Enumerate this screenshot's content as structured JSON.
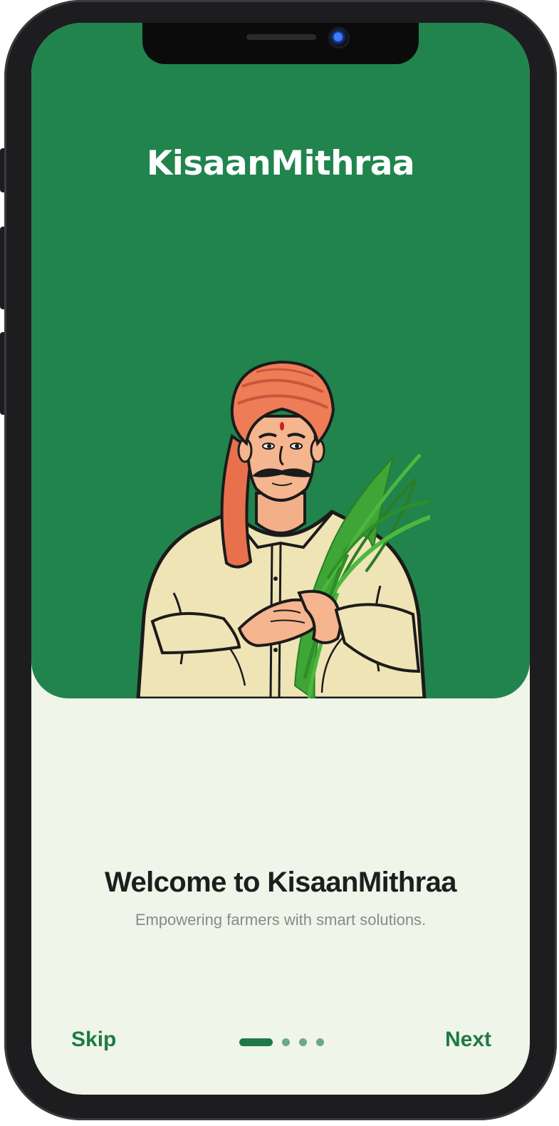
{
  "header": {
    "app_name": "KisaanMithraa"
  },
  "hero": {
    "illustration_icon": "farmer-with-crop-illustration"
  },
  "content": {
    "heading": "Welcome to KisaanMithraa",
    "subtitle": "Empowering farmers with smart solutions."
  },
  "footer": {
    "skip_label": "Skip",
    "next_label": "Next",
    "pager": {
      "total": 4,
      "current": 1
    }
  },
  "colors": {
    "brand_green": "#21844D",
    "accent_green": "#1F7A45",
    "background": "#EFF5E8",
    "heading_text": "#1E1E1E",
    "subtitle_text": "#8A8A8A"
  }
}
